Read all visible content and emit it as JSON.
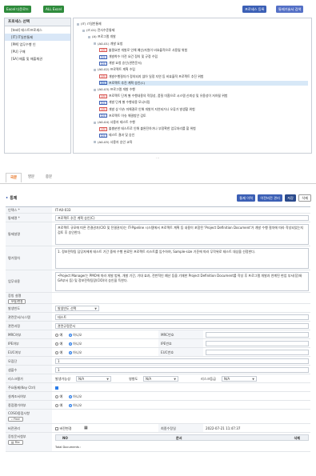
{
  "toolbar": {
    "excel_download": "Excel 다운로드",
    "all_excel": "ALL Excel",
    "process_register": "프로세스 등록",
    "stats_view": "통제기술서 검색"
  },
  "left_panel": {
    "title": "프로세스 선택",
    "items": [
      {
        "label": "[test] 테스트프로세스",
        "selected": false
      },
      {
        "label": "[IT] IT일반통제",
        "selected": true
      },
      {
        "label": "[PM] 업무수행 인",
        "selected": false
      },
      {
        "label": "[PU] 구매",
        "selected": false
      },
      {
        "label": "[SA] 매출 및 매출채권",
        "selected": false
      }
    ]
  },
  "tree": [
    {
      "indent": 0,
      "tag": "",
      "text": "(IT) IT일반통제"
    },
    {
      "indent": 1,
      "tag": "",
      "text": "(IT-01) 전사수준통제"
    },
    {
      "indent": 2,
      "tag": "",
      "text": "(A) 프로그램 개발"
    },
    {
      "indent": 3,
      "tag": "",
      "text": "(A0-01) 개발 요청"
    },
    {
      "indent": 4,
      "tag": "위험",
      "text": "불필요한 개발로 인해 예산/자원이 비효율적으로 사용될 위험"
    },
    {
      "indent": 4,
      "tag": "통제",
      "text": "개발착수 이전 요건 정의 및 규정 수립"
    },
    {
      "indent": 4,
      "tag": "통제",
      "text": "개발 요청 승인(관련문서)"
    },
    {
      "indent": 3,
      "tag": "",
      "text": "(A0-02) 프로젝트 계획 수립"
    },
    {
      "indent": 4,
      "tag": "위험",
      "text": "개발수행절차가 정의되지 않아 일정 지연 등 비효율적 프로젝트 추진 위험"
    },
    {
      "indent": 4,
      "tag": "통제",
      "text": "프로젝트 추진 계획 승인(C)",
      "selected": true
    },
    {
      "indent": 3,
      "tag": "",
      "text": "(A0-03) 프로그램 개발 수행"
    },
    {
      "indent": 4,
      "tag": "위험",
      "text": "프로젝트 단계 별 수행내용의 적정성, 품질 미흡으로 시스템 신뢰성 및 유용성이 저하될 위험"
    },
    {
      "indent": 4,
      "tag": "통제",
      "text": "개발 단계 별 수행내용 모니터링"
    },
    {
      "indent": 4,
      "tag": "위험",
      "text": "개발 상 이슈 미해결로 인해 개발이 지연되거나 오류가 발생할 위험"
    },
    {
      "indent": 4,
      "tag": "통제",
      "text": "프로젝트 이슈 해결방안 검토"
    },
    {
      "indent": 3,
      "tag": "",
      "text": "(A0-04) 사용자 테스트 수행"
    },
    {
      "indent": 4,
      "tag": "위험",
      "text": "불충분한 테스트로 인해 불완전하거나 부정확한 업무처리를 할 위험"
    },
    {
      "indent": 4,
      "tag": "통제",
      "text": "테스트 결과 및 승인"
    },
    {
      "indent": 3,
      "tag": "",
      "text": "(A0-05) 사용자 승인 교육"
    }
  ],
  "tabs": [
    "국문",
    "영문",
    "중문"
  ],
  "section": {
    "title": "통제",
    "buttons": {
      "review": "통제 이력",
      "history": "이전버전 관리",
      "save": "저장",
      "delete": "삭제"
    }
  },
  "form": {
    "id_label": "인덱스 *",
    "id_value": "IT-A0-033",
    "name_label": "통제명 *",
    "name_value": "프로젝트 추진 계획 승인(C)",
    "desc_label": "통제설명",
    "desc_value": "프로젝트 규모에 따른 전결권자(CIO 및 전결권자)는 IT-Pipeline 시스템에서 프로젝트 계획 등 내용이 포함된 'Project Definition Document'가 개발 수행 절차에 따라 작성되었는지 검토 후 승인한다.",
    "test_label": "평가절차",
    "test_value": "1. 정보전략팀 담당자에게 테스트 기간 중에 수행 완료된 프로젝트 리스트를 입수하여, Sample-size 기준에 따라 무작위로 테스트 대상을 선정한다.",
    "work_label": "업무내용",
    "work_value": "•Project Manager는 PMO에 따라 개발 범위, 개발 기간, 기대 효과, 전반적인 예산 등을 기재한 Project Definition Document를 작성 후 프로그램 개발과 연계된 현업 부서(장)와 GA부서 등) 및 정보전략팀장(CIO)의 승인을 득한다.",
    "attach_label": "증빙 설명",
    "attach_button": "보정/변경",
    "type_label": "발생빈도",
    "type_value": "발생빈도 선택",
    "related_label": "관련문서/시스템",
    "related_value": "테스트",
    "dept_label": "관련과정",
    "dept_value": "관련규정문서",
    "mrc_label": "MRC여부",
    "mrc_yes": "예",
    "mrc_no": "아니오",
    "mrc_no_label": "MRC번호",
    "ipe_label": "IPE여부",
    "ipe_yes": "예",
    "ipe_no": "아니오",
    "ipe_no_label": "IPE번호",
    "euc_label": "EUC여부",
    "euc_yes": "예",
    "euc_no": "아니오",
    "euc_no_label": "EUC번호",
    "dl_label": "모집단",
    "dl_value": "1",
    "sample_label": "샘플수",
    "sample_value": "1",
    "risk_label": "리스크평가",
    "risk_sub1": "발생가능성",
    "risk_v1": "N/A",
    "risk_sub2": "영향도",
    "risk_v2": "N/A",
    "risk_sub3": "리스크등급",
    "risk_v3": "N/A",
    "key_label": "주요통제(Key Ctrl)",
    "auto_label": "설계조서여부",
    "auto_yes": "예",
    "auto_no": "아니오",
    "gov_label": "종점평가여부",
    "gov_yes": "예",
    "gov_no": "아니오",
    "coso_label": "COSO중점사항",
    "coso_sub": "[필수]",
    "coso_button": "Find",
    "ver_label": "버전관리",
    "ver_check": "버전변경",
    "mod_label": "최종수정일",
    "mod_value": "2022-07-21 11:47:37",
    "file_label": "증빙문서첨부",
    "file_button": "File",
    "table_no": "NO",
    "table_doc": "문서",
    "table_del": "삭제",
    "total_docs": "Total Documents"
  },
  "colors": {
    "accent": "#e66b15",
    "primary": "#3b5fb5",
    "green": "#2e8b3c",
    "danger": "#d9534f"
  }
}
